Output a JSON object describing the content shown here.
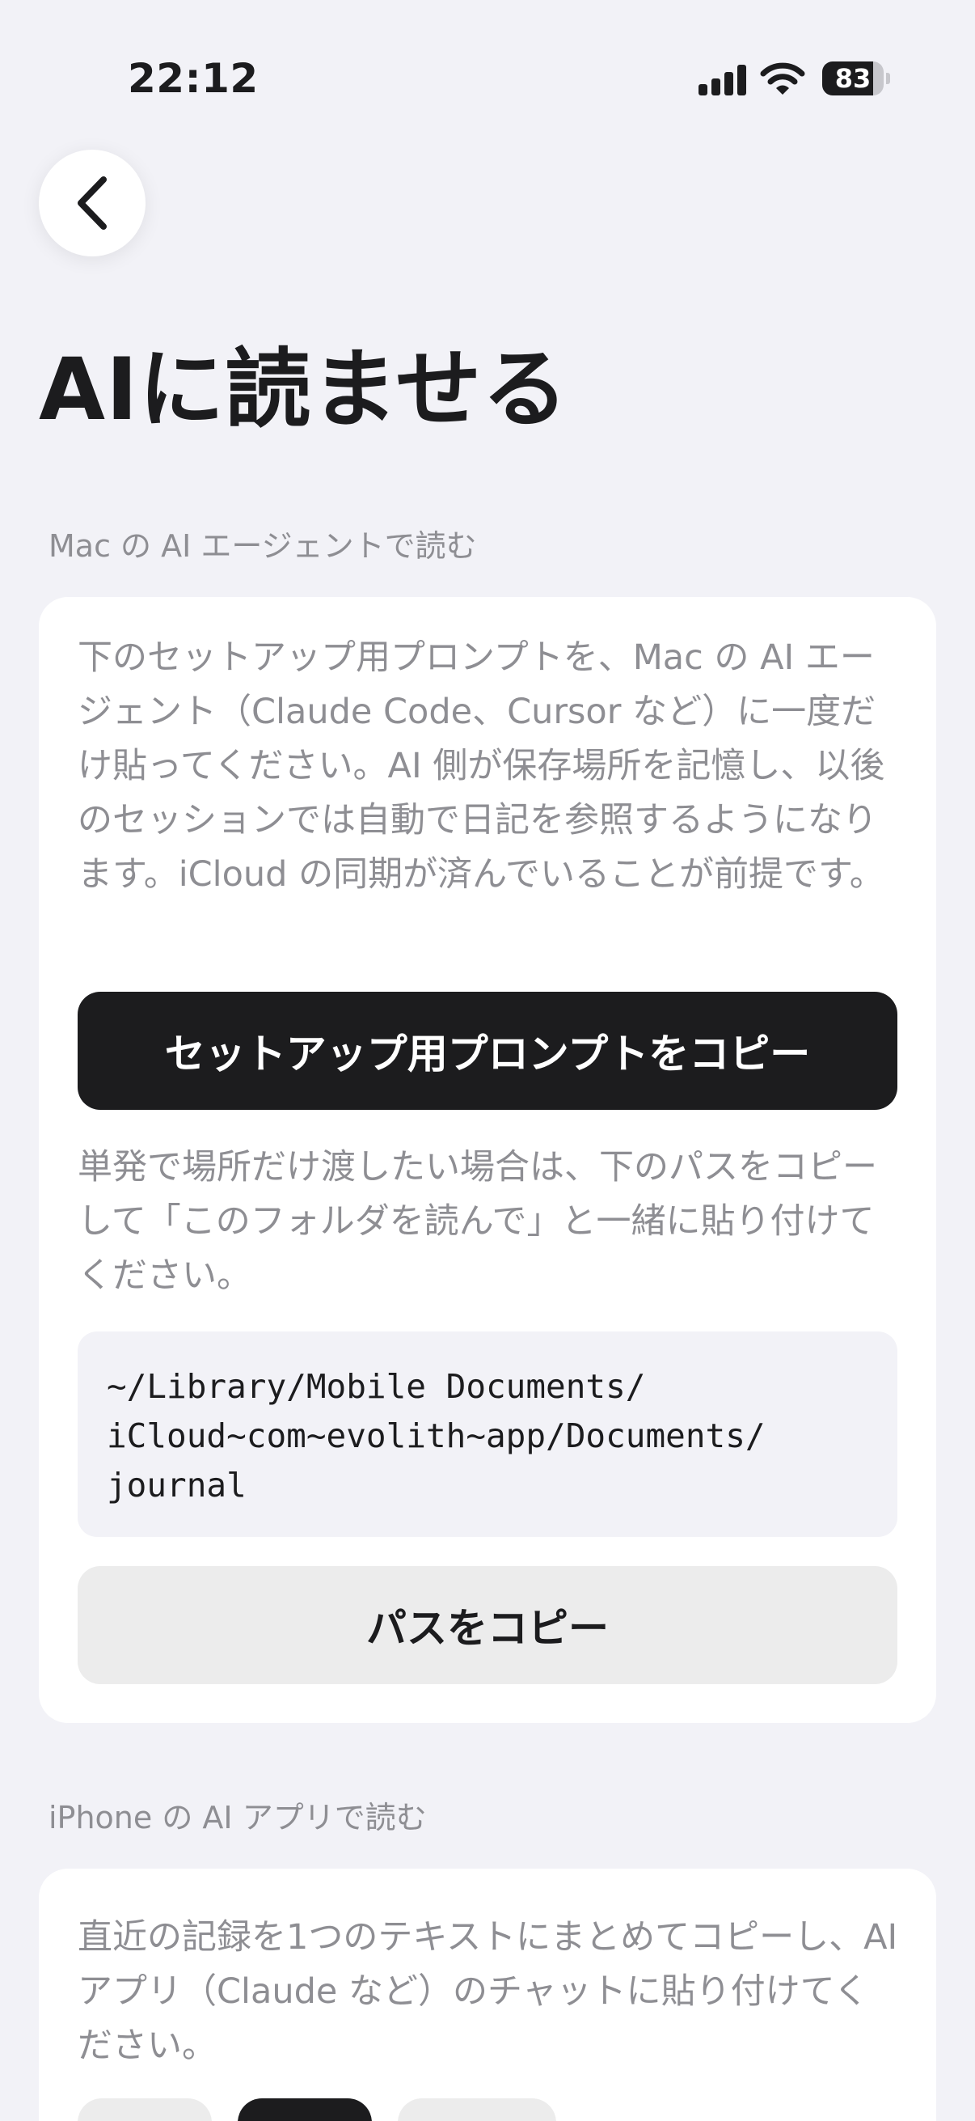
{
  "status_bar": {
    "time": "22:12",
    "battery_level": "83",
    "battery_fraction": 0.83,
    "icons": [
      "cellular-signal-icon",
      "wifi-icon",
      "battery-icon"
    ]
  },
  "nav": {
    "back_icon": "chevron-left-icon"
  },
  "page_title": "AIに読ませる",
  "mac_section": {
    "header": "Mac の AI エージェントで読む",
    "description": "下のセットアップ用プロンプトを、Mac の AI エージェント（Claude Code、Cursor など）に一度だけ貼ってください。AI 側が保存場所を記憶し、以後のセッションでは自動で日記を参照するようになります。iCloud の同期が済んでいることが前提です。",
    "copy_prompt_label": "セットアップ用プロンプトをコピー",
    "path_description": "単発で場所だけ渡したい場合は、下のパスをコピーして「このフォルダを読んで」と一緒に貼り付けてください。",
    "path_lines": [
      "~/Library/Mobile Documents/",
      "iCloud~com~evolith~app/Documents/",
      "journal"
    ],
    "copy_path_label": "パスをコピー"
  },
  "iphone_section": {
    "header": "iPhone の AI アプリで読む",
    "description": "直近の記録を1つのテキストにまとめてコピーし、AI アプリ（Claude など）のチャットに貼り付けてください。"
  },
  "colors": {
    "background": "#f2f2f7",
    "card": "#ffffff",
    "primary_button": "#1c1c1e",
    "secondary_button": "#ececec",
    "secondary_text": "#8e8e93"
  }
}
